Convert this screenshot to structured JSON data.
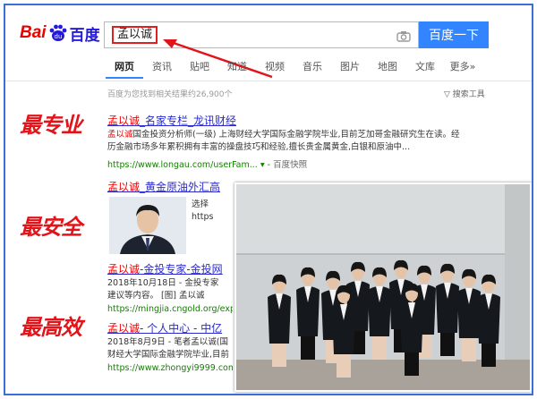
{
  "logo": {
    "bai": "Bai",
    "du": "百度"
  },
  "search": {
    "query": "孟以诚",
    "button": "百度一下"
  },
  "tabs": [
    {
      "label": "网页",
      "active": true
    },
    {
      "label": "资讯"
    },
    {
      "label": "贴吧"
    },
    {
      "label": "知道"
    },
    {
      "label": "视频"
    },
    {
      "label": "音乐"
    },
    {
      "label": "图片"
    },
    {
      "label": "地图"
    },
    {
      "label": "文库"
    },
    {
      "label": "更多»"
    }
  ],
  "result_count": "百度为您找到相关结果约26,900个",
  "search_tools": "搜索工具",
  "slogans": [
    "最专业",
    "最安全",
    "最高效"
  ],
  "results": [
    {
      "title_hl": "孟以诚",
      "title_rest": "_名家专栏_龙讯财经",
      "lines": [
        [
          "孟以诚",
          "国金投资分析师(一级) 上海财经大学国际金融学院毕业,目前芝加哥金融研究生在读。经"
        ],
        [
          "",
          "历金融市场多年累积拥有丰富的操盘技巧和经验,擅长贵金属黄金,白银和原油中..."
        ]
      ],
      "url": "https://www.longau.com/userFam...",
      "snapshot": "百度快照"
    },
    {
      "title_hl": "孟以诚",
      "title_rest": "_黄金原油外汇高",
      "lines": [
        [
          "",
          "选择"
        ],
        [
          "",
          "https"
        ]
      ]
    },
    {
      "title_hl": "孟以诚",
      "title_rest": "-金投专家-金投网",
      "lines": [
        [
          "",
          "2018年10月18日 - 金投专家"
        ],
        [
          "",
          "建议等内容。 [图] 孟以诚"
        ]
      ],
      "url": "https://mingjia.cngold.org/exp..."
    },
    {
      "title_hl": "孟以诚",
      "title_rest": "- 个人中心 - 中亿",
      "lines": [
        [
          "",
          "2018年8月9日 - 笔者孟以诚(国"
        ],
        [
          "",
          "财经大学国际金融学院毕业,目前"
        ]
      ],
      "url": "https://www.zhongyi9999.com/m..."
    }
  ],
  "colors": {
    "accent": "#3385ff",
    "slogan": "#e2141a",
    "link": "#2a2ad0",
    "url": "#138000"
  }
}
